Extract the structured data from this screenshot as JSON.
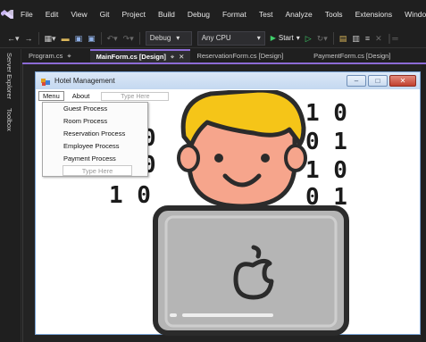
{
  "menubar": {
    "items": [
      "File",
      "Edit",
      "View",
      "Git",
      "Project",
      "Build",
      "Debug",
      "Format",
      "Test",
      "Analyze",
      "Tools",
      "Extensions",
      "Window"
    ]
  },
  "toolbar": {
    "config": "Debug",
    "platform": "Any CPU",
    "start_label": "Start"
  },
  "side_tabs": {
    "server_explorer": "Server Explorer",
    "toolbox": "Toolbox"
  },
  "tabs": [
    {
      "label": "Program.cs",
      "pin": "⌂",
      "active": false
    },
    {
      "label": "MainForm.cs [Design]",
      "pin": "⌂",
      "active": true
    },
    {
      "label": "ReservationForm.cs [Design]",
      "active": false
    },
    {
      "label": "PaymentForm.cs [Design]",
      "active": false
    }
  ],
  "form": {
    "title": "Hotel Management",
    "menu": {
      "menu_label": "Menu",
      "about_label": "About",
      "type_here": "Type Here"
    },
    "dropdown": {
      "items": [
        "Guest Process",
        "Room Process",
        "Reservation Process",
        "Employee Process",
        "Payment Process"
      ],
      "type_here": "Type Here"
    }
  },
  "illustration": {
    "binary_left": [
      "1 0"
    ],
    "binary_right": [
      "1 0",
      "0 1",
      "1 0",
      "0 1"
    ],
    "binary_left_lines": [
      "0",
      "0",
      "1 0"
    ]
  },
  "colors": {
    "accent": "#8c6bd6",
    "hair": "#f5c518",
    "skin": "#f6a58c",
    "laptop": "#b5b5b5",
    "outline": "#2b2b2b"
  }
}
